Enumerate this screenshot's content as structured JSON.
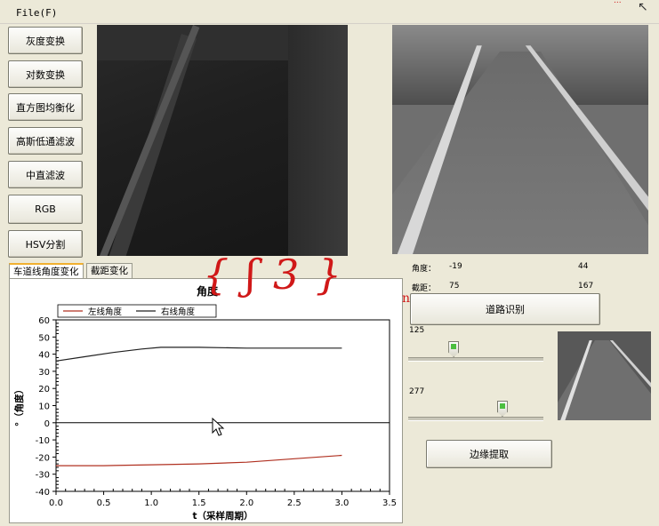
{
  "menu": {
    "file": "File(F)"
  },
  "title_fragment": "...",
  "left_buttons": [
    "灰度变换",
    "对数变换",
    "直方图均衡化",
    "高斯低通滤波",
    "中直滤波",
    "RGB",
    "HSV分割"
  ],
  "tabs": [
    "车道线角度变化",
    "截距变化"
  ],
  "chart_overlay_text": "{ ʃ 3 }",
  "info": {
    "angle_label": "角度：",
    "angle_left": "-19",
    "angle_right": "44",
    "intercept_label": "截距：",
    "intercept_left": "75",
    "intercept_right": "167"
  },
  "buttons": {
    "road_detect": "道路识别",
    "edge_extract": "边缘提取"
  },
  "sliders": [
    {
      "label": "125",
      "value": 125,
      "position": 0.33
    },
    {
      "label": "277",
      "value": 277,
      "position": 0.69
    }
  ],
  "colors": {
    "left_series": "#b03020",
    "right_series": "#202020",
    "zero_line": "#000000",
    "window_bg": "#ece9d8"
  },
  "chart_data": {
    "type": "line",
    "title": "角度",
    "xlabel": "t（采样周期）",
    "ylabel": "°（角度）",
    "xlim": [
      0,
      3.5
    ],
    "ylim": [
      -40,
      60
    ],
    "xticks": [
      "0.0",
      "0.5",
      "1.0",
      "1.5",
      "2.0",
      "2.5",
      "3.0",
      "3.5"
    ],
    "yticks": [
      "60",
      "50",
      "40",
      "30",
      "20",
      "10",
      "0",
      "-10",
      "-20",
      "-30",
      "-40"
    ],
    "legend_position": "top-left",
    "series": [
      {
        "name": "左线角度",
        "color": "#b03020",
        "x": [
          0.0,
          0.5,
          1.0,
          1.5,
          2.0,
          2.5,
          3.0
        ],
        "y": [
          -25,
          -25,
          -24.5,
          -24,
          -23,
          -21,
          -19
        ]
      },
      {
        "name": "右线角度",
        "color": "#202020",
        "x": [
          0.0,
          0.3,
          0.6,
          0.9,
          1.1,
          1.5,
          2.0,
          2.5,
          3.0
        ],
        "y": [
          36,
          38.5,
          41,
          43,
          44,
          44,
          43.5,
          43.5,
          43.5
        ]
      }
    ]
  }
}
